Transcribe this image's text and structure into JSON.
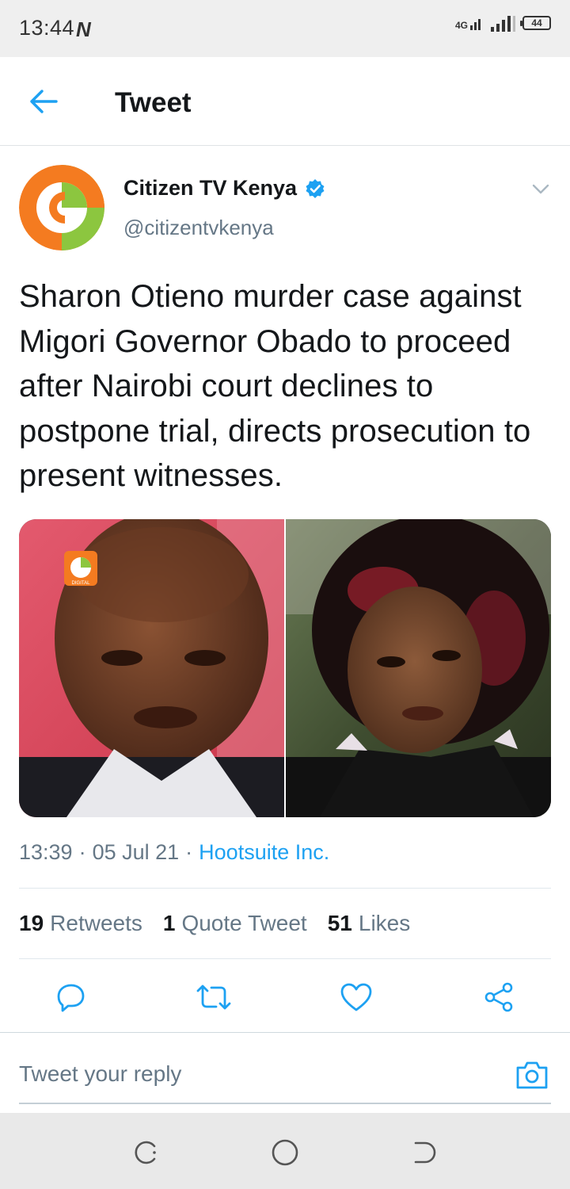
{
  "status_bar": {
    "time": "13:44",
    "carrier_icon": "N",
    "network_type": "4G",
    "battery_level": "44"
  },
  "header": {
    "back_icon": "arrow-left-icon",
    "title": "Tweet"
  },
  "tweet": {
    "author_name": "Citizen TV Kenya",
    "verified_icon": "verified-badge-icon",
    "author_handle": "@citizentvkenya",
    "text": "Sharon Otieno murder case against Migori Governor Obado to proceed after Nairobi court declines to postpone trial, directs prosecution to present witnesses.",
    "media_logo_label": "DIGITAL",
    "time": "13:39",
    "date": "05 Jul 21",
    "source": "Hootsuite Inc.",
    "separator": "·"
  },
  "stats": {
    "retweets_count": "19",
    "retweets_label": "Retweets",
    "quotes_count": "1",
    "quotes_label": "Quote Tweet",
    "likes_count": "51",
    "likes_label": "Likes"
  },
  "actions": {
    "reply_icon": "reply-icon",
    "retweet_icon": "retweet-icon",
    "like_icon": "heart-icon",
    "share_icon": "share-icon"
  },
  "reply_bar": {
    "placeholder": "Tweet your reply",
    "camera_icon": "camera-icon"
  },
  "nav_bar": {
    "recents_icon": "recents-icon",
    "home_icon": "home-circle-icon",
    "back_icon": "nav-back-icon"
  },
  "colors": {
    "accent": "#1da1f2",
    "text_primary": "#14171a",
    "text_secondary": "#657786",
    "logo_orange": "#f47b20",
    "logo_green": "#8cc63f"
  }
}
